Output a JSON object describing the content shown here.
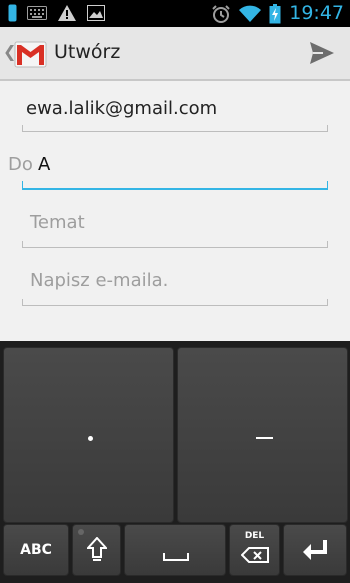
{
  "status_bar": {
    "time": "19:47",
    "icons": [
      "phone-icon",
      "keyboard-icon",
      "warning-icon",
      "picture-icon",
      "alarm-icon",
      "wifi-icon",
      "battery-charging-icon"
    ]
  },
  "action_bar": {
    "title": "Utwórz",
    "icons": [
      "up-chevron-icon",
      "gmail-logo",
      "send-icon"
    ]
  },
  "compose": {
    "from": "ewa.lalik@gmail.com",
    "to_label": "Do",
    "to_value": "A",
    "subject_placeholder": "Temat",
    "body_placeholder": "Napisz e-maila."
  },
  "keyboard": {
    "abc_label": "ABC",
    "del_label": "DEL",
    "big_keys": [
      "dot-key",
      "dash-key"
    ],
    "icons": [
      "shift-icon",
      "space-icon",
      "backspace-icon",
      "enter-icon"
    ]
  },
  "colors": {
    "accent": "#33b5e5",
    "keyboard_bg": "#1e1e1e",
    "key": "#424242",
    "compose_bg": "#f1f1f1",
    "action_bar_bg": "#e6e6e6"
  }
}
